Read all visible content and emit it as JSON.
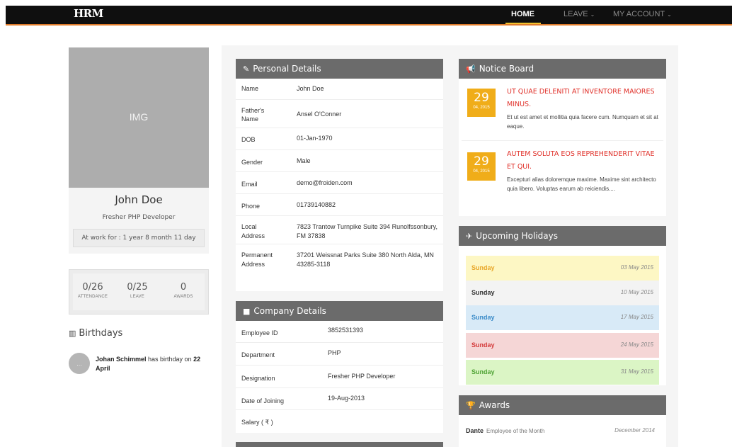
{
  "nav": {
    "logo": "HRM",
    "home": "HOME",
    "leave": "LEAVE",
    "account": "MY ACCOUNT",
    "caret": "⌄"
  },
  "profile": {
    "img_placeholder": "IMG",
    "name": "John Doe",
    "role": "Fresher PHP Developer",
    "at_work": "At work for : 1 year 8 month 11 day"
  },
  "stats": [
    {
      "value": "0/26",
      "label": "ATTENDANCE"
    },
    {
      "value": "0/25",
      "label": "LEAVE"
    },
    {
      "value": "0",
      "label": "AWARDS"
    }
  ],
  "birthdays": {
    "title": "Birthdays",
    "icon": "birthday-cake-icon",
    "avatar_text": "...",
    "name": "Johan Schimmel",
    "text": " has birthday on ",
    "date": "22 April"
  },
  "personal": {
    "title": "Personal Details",
    "icon": "pencil-icon",
    "rows": [
      {
        "k": "Name",
        "v": "John Doe"
      },
      {
        "k": "Father's Name",
        "v": "Ansel O'Conner"
      },
      {
        "k": "DOB",
        "v": "01-Jan-1970"
      },
      {
        "k": "Gender",
        "v": "Male"
      },
      {
        "k": "Email",
        "v": "demo@froiden.com"
      },
      {
        "k": "Phone",
        "v": "01739140882"
      },
      {
        "k": "Local Address",
        "v": "7823 Trantow Turnpike Suite 394 Runolfssonbury, FM 37838"
      },
      {
        "k": "Permanent Address",
        "v": "37201 Weissnat Parks Suite 380 North Alda, MN 43285-3118"
      }
    ]
  },
  "company": {
    "title": "Company Details",
    "icon": "briefcase-icon",
    "rows": [
      {
        "k": "Employee ID",
        "v": "3852531393"
      },
      {
        "k": "Department",
        "v": "PHP"
      },
      {
        "k": "Designation",
        "v": "Fresher PHP Developer"
      },
      {
        "k": "Date of Joining",
        "v": "19-Aug-2013"
      },
      {
        "k": "Salary ( ₹ )",
        "v": ""
      }
    ]
  },
  "notice": {
    "title": "Notice Board",
    "icon": "bullhorn-icon",
    "items": [
      {
        "day": "29",
        "month_year": "04, 2015",
        "title": "UT QUAE DELENITI AT INVENTORE MAIORES MINUS.",
        "body": "Et ut est amet et mollitia quia facere cum. Numquam et sit at eaque."
      },
      {
        "day": "29",
        "month_year": "04, 2015",
        "title": "AUTEM SOLUTA EOS REPREHENDERIT VITAE ET QUI.",
        "body": "Excepturi alias doloremque maxime. Maxime sint architecto quia libero. Voluptas earum ab reiciendis...."
      }
    ]
  },
  "holidays": {
    "title": "Upcoming Holidays",
    "icon": "plane-icon",
    "items": [
      {
        "day": "Sunday",
        "date": "03 May 2015",
        "bg": "#fdf7c4",
        "fg": "#e8a628"
      },
      {
        "day": "Sunday",
        "date": "10 May 2015",
        "bg": "#f3f3f3",
        "fg": "#333333"
      },
      {
        "day": "Sunday",
        "date": "17 May 2015",
        "bg": "#d8eaf7",
        "fg": "#3a8bc8"
      },
      {
        "day": "Sunday",
        "date": "24 May 2015",
        "bg": "#f5d6d6",
        "fg": "#d43a3a"
      },
      {
        "day": "Sunday",
        "date": "31 May 2015",
        "bg": "#dbf5c5",
        "fg": "#4fa334"
      }
    ]
  },
  "awards": {
    "title": "Awards",
    "icon": "trophy-icon",
    "items": [
      {
        "name": "Dante",
        "title": "Employee of the Month",
        "date": "December 2014"
      }
    ]
  },
  "colors": {
    "topbar": "#0f0f0f",
    "accent_orange": "#e07b2a",
    "panel_header": "#6b6b6b",
    "notice_date": "#f0ad19",
    "notice_title": "#e0312a"
  }
}
